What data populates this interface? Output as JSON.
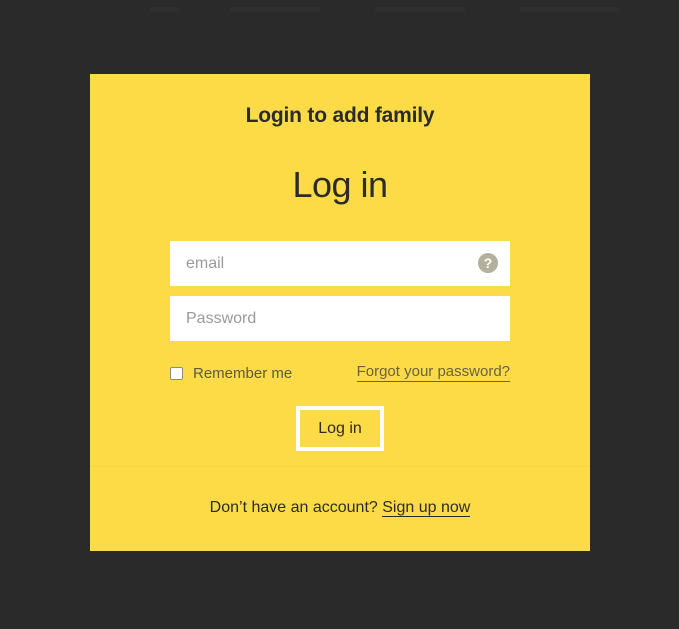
{
  "modal": {
    "heading": "Login to add family",
    "title": "Log in",
    "email": {
      "placeholder": "email",
      "value": "",
      "help_icon": "question-circle-icon",
      "help_glyph": "?"
    },
    "password": {
      "placeholder": "Password",
      "value": ""
    },
    "remember_label": "Remember me",
    "remember_checked": false,
    "forgot_link": "Forgot your password?",
    "login_button": "Log in",
    "signup_prompt": "Don’t have an account?",
    "signup_link": "Sign up now"
  },
  "colors": {
    "modal_bg": "#fddb47",
    "backdrop": "#2a2a2a",
    "text": "#2b2b2b"
  }
}
